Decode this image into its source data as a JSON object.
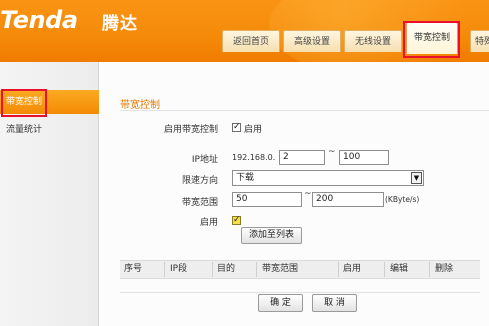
{
  "header": {
    "logo": "Tenda",
    "logo_cn": "腾达",
    "tabs": [
      {
        "label": "返回首页"
      },
      {
        "label": "高级设置"
      },
      {
        "label": "无线设置"
      },
      {
        "label": "带宽控制",
        "active": true
      },
      {
        "label": "特殊"
      }
    ]
  },
  "sidebar": {
    "items": [
      {
        "label": "带宽控制",
        "active": true
      },
      {
        "label": "流量统计"
      }
    ]
  },
  "main": {
    "section_title": "带宽控制",
    "enable_bw": {
      "label": "启用带宽控制",
      "check_text": "启用",
      "checked": true
    },
    "ip": {
      "label": "IP地址",
      "prefix": "192.168.0.",
      "start": "2",
      "sep": "~",
      "end": "100"
    },
    "direction": {
      "label": "限速方向",
      "value": "下载"
    },
    "range": {
      "label": "带宽范围",
      "min": "50",
      "sep": "~",
      "max": "200",
      "unit": "(KByte/s)"
    },
    "enable": {
      "label": "启用",
      "checked": true
    },
    "add_button": "添加至列表",
    "table": {
      "headers": [
        "序号",
        "IP段",
        "目的",
        "带宽范围",
        "启用",
        "编辑",
        "删除"
      ]
    },
    "ok_button": "确 定",
    "cancel_button": "取 消"
  },
  "colors": {
    "header_orange": "#f58a09",
    "active_side": "#f38a04",
    "title_orange": "#e07a00",
    "highlight_red": "#e8102a"
  }
}
